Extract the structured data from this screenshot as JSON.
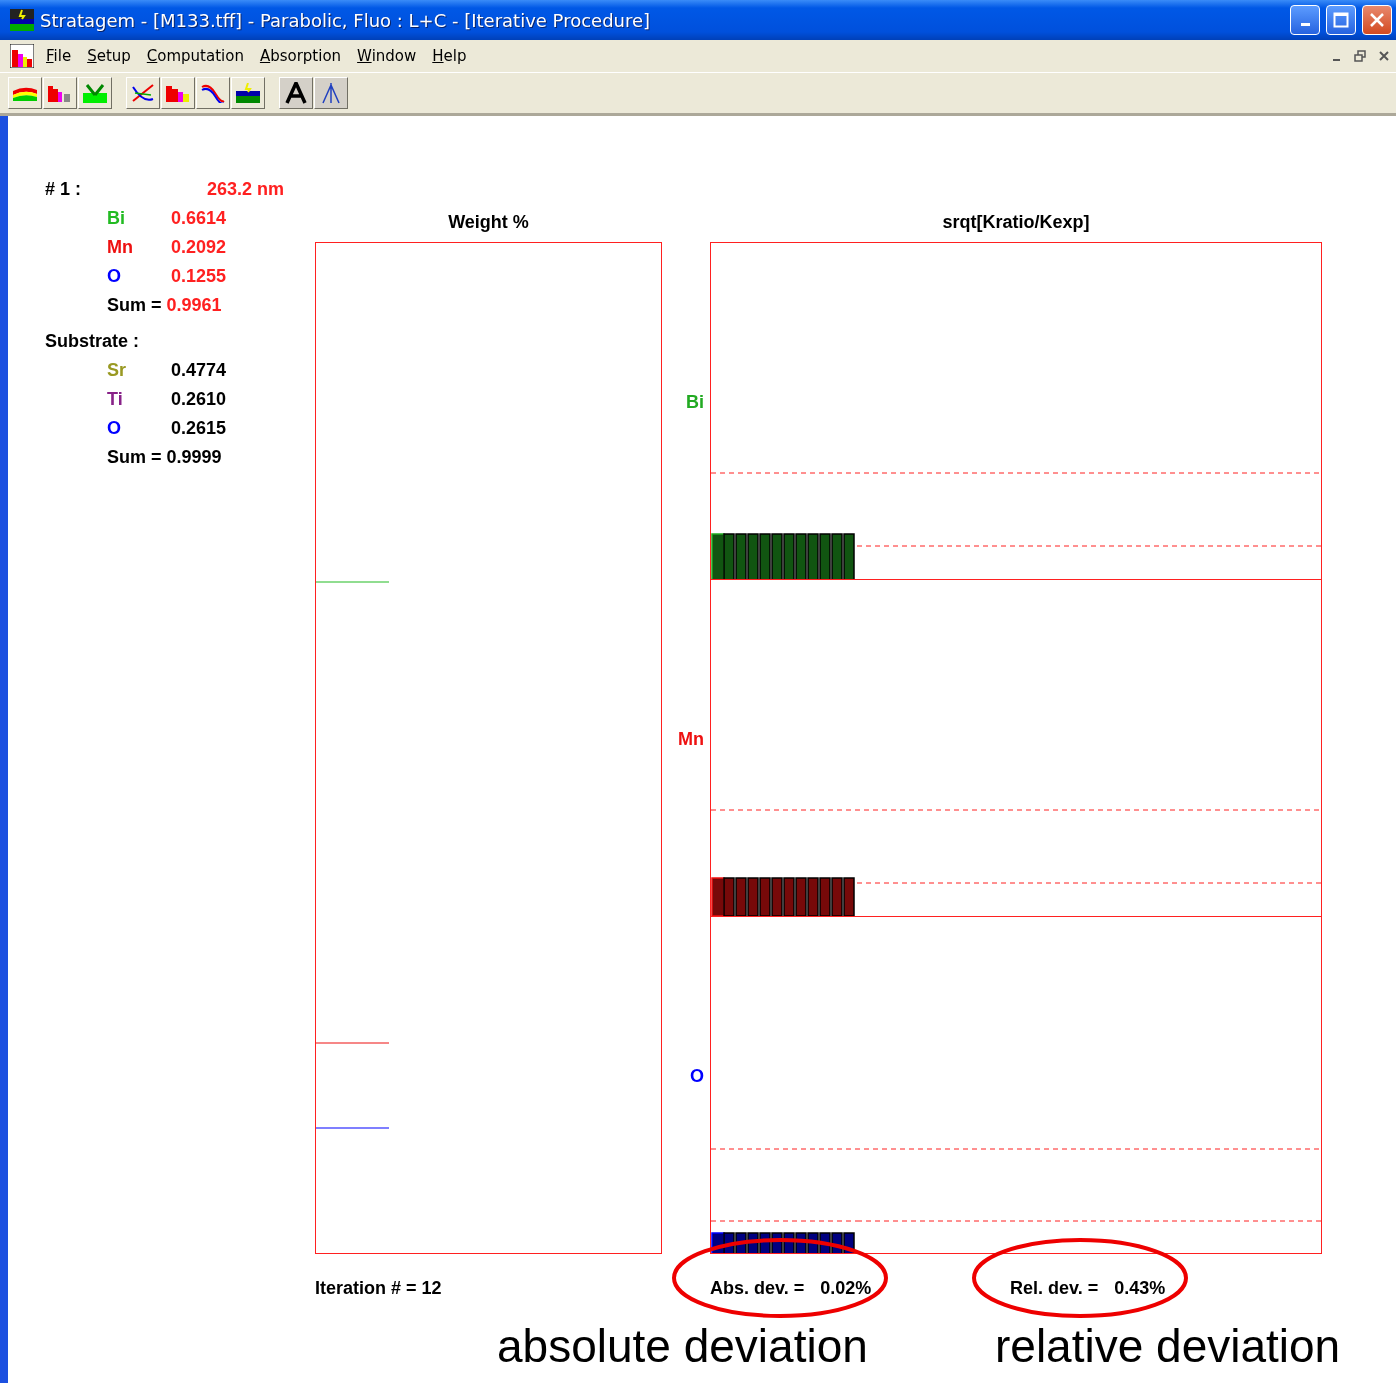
{
  "window": {
    "title": "Stratagem - [M133.tff] - Parabolic, Fluo : L+C - [Iterative Procedure]"
  },
  "menu": [
    "File",
    "Setup",
    "Computation",
    "Absorption",
    "Window",
    "Help"
  ],
  "layer": {
    "label": "# 1 :",
    "thickness": "263.2 nm",
    "sum_label": "Sum =",
    "sum": "0.9961",
    "elements": [
      {
        "symbol": "Bi",
        "color": "#22bb22",
        "value": "0.6614"
      },
      {
        "symbol": "Mn",
        "color": "#ee1111",
        "value": "0.2092"
      },
      {
        "symbol": "O",
        "color": "#0000ff",
        "value": "0.1255"
      }
    ]
  },
  "substrate": {
    "label": "Substrate :",
    "sum_label": "Sum =",
    "sum": "0.9999",
    "elements": [
      {
        "symbol": "Sr",
        "color": "#999922",
        "value": "0.4774"
      },
      {
        "symbol": "Ti",
        "color": "#882288",
        "value": "0.2610"
      },
      {
        "symbol": "O",
        "color": "#0000ff",
        "value": "0.2615"
      }
    ]
  },
  "weight_plot": {
    "title": "Weight %"
  },
  "ratio_plot": {
    "title": "srqt[Kratio/Kexp]",
    "rows": [
      {
        "symbol": "Bi",
        "color": "#22aa22"
      },
      {
        "symbol": "Mn",
        "color": "#ee1111"
      },
      {
        "symbol": "O",
        "color": "#0000ff"
      }
    ]
  },
  "stats": [
    {
      "text": "Iteration # = 12",
      "circled": false
    },
    {
      "label": "Abs. dev. =",
      "value": "0.02%",
      "circled": true
    },
    {
      "label": "Rel. dev. =",
      "value": "0.43%",
      "circled": true
    }
  ],
  "annotations": [
    "absolute deviation",
    "relative deviation"
  ]
}
